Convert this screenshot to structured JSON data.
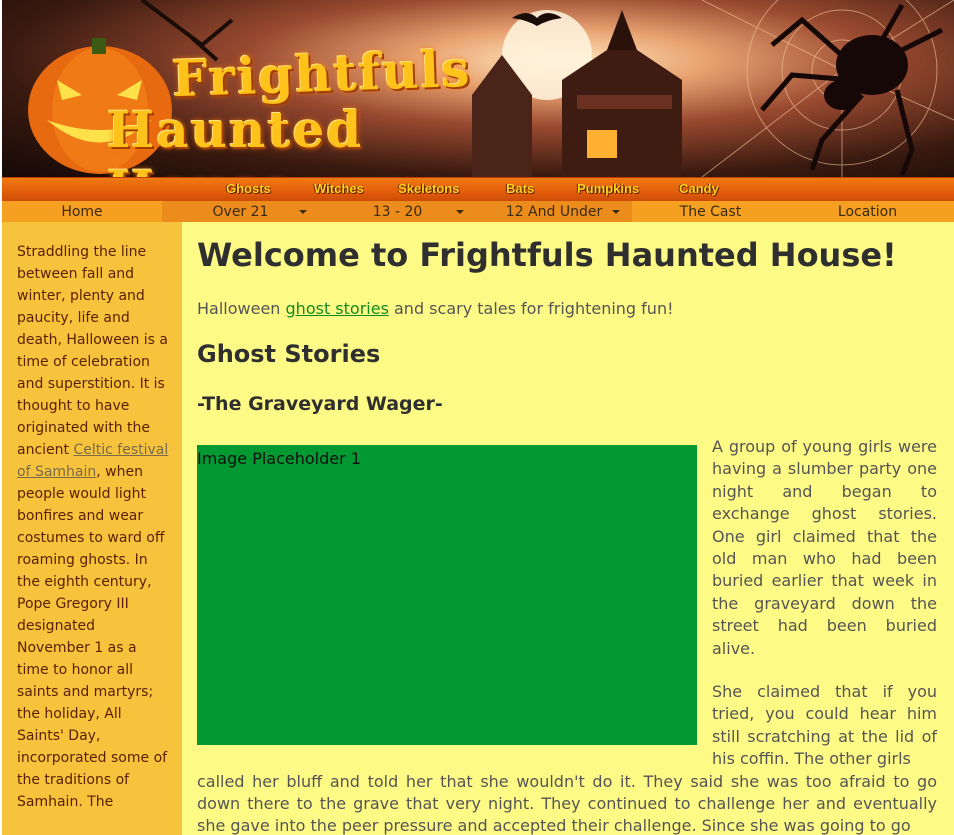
{
  "banner": {
    "logo_line1": "Frightfuls",
    "logo_line2": "Haunted House"
  },
  "topnav": {
    "items": [
      "Ghosts",
      "Witches",
      "Skeletons",
      "Bats",
      "Pumpkins",
      "Candy"
    ]
  },
  "subnav": {
    "items": [
      "Home",
      "Over 21",
      "13 - 20",
      "12 And Under",
      "The Cast",
      "Location"
    ]
  },
  "sidebar": {
    "text_before_link": "Straddling the line between fall and winter, plenty and paucity, life and death, Halloween is a time of celebration and superstition. It is thought to have originated with the ancient ",
    "link": "Celtic festival of Samhain",
    "text_after_link": ", when people would light bonfires and wear costumes to ward off roaming ghosts. In the eighth century, Pope Gregory III designated November 1 as a time to honor all saints and martyrs; the holiday, All Saints' Day, incorporated some of the traditions of Samhain. The"
  },
  "main": {
    "title": "Welcome to Frightfuls Haunted House!",
    "intro_before": "Halloween ",
    "intro_link": "ghost stories",
    "intro_after": " and scary tales for frightening fun!",
    "section_heading": "Ghost Stories",
    "story_title": "-The Graveyard Wager-",
    "image_placeholder": "Image Placeholder 1",
    "story_p1": "A group of young girls were having a slumber party one night and began to exchange ghost stories. One girl claimed that the old man who had been buried earlier that week in the graveyard down the street had been buried alive.",
    "story_p2_start": "She claimed that if you tried, you could hear him still scratching at the lid of his coffin. The other girls",
    "story_p2_rest": "called her bluff and told her that she wouldn't do it. They said she was too afraid to go down there to the grave that very night. They continued to challenge her and eventually she gave into the peer pressure and accepted their challenge. Since she was going to go"
  },
  "colors": {
    "sidebar_bg": "#f8c33c",
    "main_bg": "#fdfa86",
    "nav_orange": "#e35c0a",
    "link_green": "#138a20",
    "placeholder_green": "#029933"
  }
}
